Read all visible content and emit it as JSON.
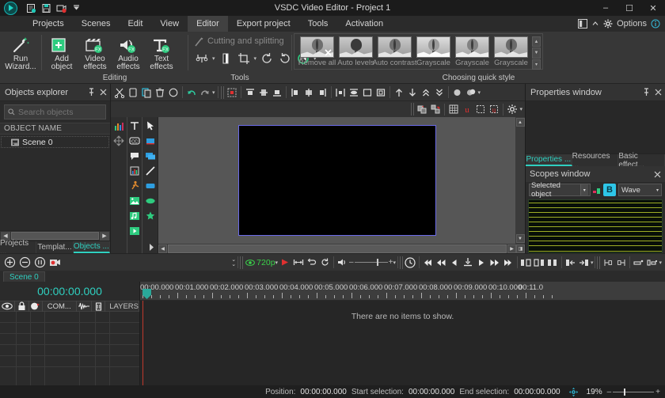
{
  "titlebar": {
    "app_title": "VSDC Video Editor - Project 1",
    "quick_access": [
      {
        "name": "new-project-icon",
        "label": "New project"
      },
      {
        "name": "save-project-icon",
        "label": "Save project"
      },
      {
        "name": "record-icon",
        "label": "Record"
      },
      {
        "name": "customize-qat-icon",
        "label": "Customize"
      }
    ],
    "window_controls": {
      "minimize": "–",
      "maximize": "☐",
      "close": "✕"
    }
  },
  "menu": {
    "items": [
      {
        "label": "Projects",
        "active": false
      },
      {
        "label": "Scenes",
        "active": false
      },
      {
        "label": "Edit",
        "active": false
      },
      {
        "label": "View",
        "active": false
      },
      {
        "label": "Editor",
        "active": true
      },
      {
        "label": "Export project",
        "active": false
      },
      {
        "label": "Tools",
        "active": false
      },
      {
        "label": "Activation",
        "active": false
      }
    ],
    "options_label": "Options"
  },
  "ribbon": {
    "wizard": {
      "label_line1": "Run",
      "label_line2": "Wizard...",
      "icon": "magic-wand-icon"
    },
    "editing": {
      "group_label": "Editing",
      "buttons": [
        {
          "label_line1": "Add",
          "label_line2": "object",
          "icon": "add-object-icon"
        },
        {
          "label_line1": "Video",
          "label_line2": "effects",
          "icon": "video-effects-icon"
        },
        {
          "label_line1": "Audio",
          "label_line2": "effects",
          "icon": "audio-effects-icon"
        },
        {
          "label_line1": "Text",
          "label_line2": "effects",
          "icon": "text-effects-icon"
        }
      ]
    },
    "tools": {
      "group_label": "Tools",
      "cutting_label": "Cutting and splitting",
      "buttons": [
        {
          "name": "split-icon"
        },
        {
          "name": "marker-icon"
        },
        {
          "name": "crop-icon"
        },
        {
          "name": "rotate-cw-icon"
        },
        {
          "name": "rotate-ccw-icon"
        },
        {
          "name": "color-wheel-icon"
        }
      ]
    },
    "quick_style": {
      "group_label": "Choosing quick style",
      "items": [
        {
          "label": "Remove all"
        },
        {
          "label": "Auto levels"
        },
        {
          "label": "Auto contrast"
        },
        {
          "label": "Grayscale"
        },
        {
          "label": "Grayscale"
        },
        {
          "label": "Grayscale"
        }
      ]
    }
  },
  "objects_explorer": {
    "title": "Objects explorer",
    "search_placeholder": "Search objects",
    "search_value": "",
    "column_header": "OBJECT NAME",
    "rows": [
      {
        "label": "Scene 0",
        "icon": "scene-icon"
      }
    ],
    "tabs": [
      {
        "label": "Projects ...",
        "active": false
      },
      {
        "label": "Templat...",
        "active": false
      },
      {
        "label": "Objects ...",
        "active": true
      }
    ]
  },
  "editor_toolbar": {
    "buttons": [
      {
        "name": "cut-icon"
      },
      {
        "name": "copy-icon"
      },
      {
        "name": "paste-icon"
      },
      {
        "name": "delete-icon"
      },
      {
        "name": "select-ellipse-icon"
      },
      {
        "name": "undo-icon"
      },
      {
        "name": "redo-icon"
      },
      {
        "name": "transform-icon"
      },
      {
        "name": "align-top-icon"
      },
      {
        "name": "align-middle-icon"
      },
      {
        "name": "align-bottom-icon"
      },
      {
        "name": "align-left-icon"
      },
      {
        "name": "align-center-icon"
      },
      {
        "name": "align-right-icon"
      },
      {
        "name": "distribute-h-icon"
      },
      {
        "name": "distribute-v-icon"
      },
      {
        "name": "fit-icon"
      },
      {
        "name": "center-icon"
      },
      {
        "name": "move-up-icon"
      },
      {
        "name": "move-down-icon"
      },
      {
        "name": "bring-front-icon"
      },
      {
        "name": "send-back-icon"
      },
      {
        "name": "group-icon"
      },
      {
        "name": "ungroup-icon"
      }
    ],
    "row2": [
      {
        "name": "duplicate-icon"
      },
      {
        "name": "link-icon"
      },
      {
        "name": "grid-icon"
      },
      {
        "name": "units-icon"
      },
      {
        "name": "snap-icon"
      },
      {
        "name": "units2-icon"
      },
      {
        "name": "settings-gear-icon"
      }
    ]
  },
  "vertical_tools": {
    "left": [
      {
        "name": "chart-bars-icon"
      },
      {
        "name": "move-tool-icon"
      }
    ],
    "middle": [
      {
        "name": "text-tool-icon"
      },
      {
        "name": "subtitle-tool-icon"
      },
      {
        "name": "speech-bubble-icon"
      },
      {
        "name": "chart-tool-icon"
      },
      {
        "name": "sprite-tool-icon"
      },
      {
        "name": "image-tool-icon"
      },
      {
        "name": "audio-tool-icon"
      },
      {
        "name": "video-tool-icon"
      }
    ],
    "right": [
      {
        "name": "pointer-tool-icon"
      },
      {
        "name": "rectangle-filled-icon"
      },
      {
        "name": "layers-icon"
      },
      {
        "name": "line-tool-icon"
      },
      {
        "name": "rounded-rect-icon"
      },
      {
        "name": "ellipse-tool-icon"
      },
      {
        "name": "star-tool-icon"
      }
    ],
    "expand": "expand-arrow-icon"
  },
  "playback": {
    "left_buttons": [
      {
        "name": "zoom-in-icon"
      },
      {
        "name": "zoom-out-icon"
      },
      {
        "name": "zoom-fit-icon"
      },
      {
        "name": "snapshot-icon"
      }
    ],
    "resolution": "720p",
    "preview_buttons": [
      {
        "name": "play-preview-icon"
      },
      {
        "name": "region-preview-icon"
      },
      {
        "name": "loop-back-icon"
      },
      {
        "name": "loop-icon"
      }
    ],
    "volume_icon": "volume-icon",
    "volume_minus": "–",
    "volume_plus": "+",
    "transport": [
      {
        "name": "clock-icon"
      },
      {
        "name": "skip-start-icon"
      },
      {
        "name": "rewind-icon"
      },
      {
        "name": "prev-frame-icon"
      },
      {
        "name": "marker-drop-icon"
      },
      {
        "name": "play-icon"
      },
      {
        "name": "fast-forward-icon"
      },
      {
        "name": "skip-end-icon"
      },
      {
        "name": "split-left-icon"
      },
      {
        "name": "split-right-icon"
      },
      {
        "name": "split-both-icon"
      },
      {
        "name": "trim-in-icon"
      },
      {
        "name": "trim-out-icon"
      },
      {
        "name": "cut-region-icon"
      },
      {
        "name": "delete-region-icon"
      },
      {
        "name": "prop-a-icon"
      },
      {
        "name": "prop-b-icon"
      }
    ]
  },
  "timeline": {
    "scene_tab": "Scene 0",
    "timecode": "00:00:00.000",
    "track_header": {
      "eye_icon": "visibility-icon",
      "lock_icon": "lock-icon",
      "mask_icon": "mask-icon",
      "compose_label": "COM...",
      "wave_icon": "waveform-icon",
      "trash_icon": "trash-icon",
      "layers_label": "LAYERS"
    },
    "empty_message": "There are no items to show.",
    "ruler_labels": [
      "00:00.000",
      "00:01.000",
      "00:02.000",
      "00:03.000",
      "00:04.000",
      "00:05.000",
      "00:06.000",
      "00:07.000",
      "00:08.000",
      "00:09.000",
      "00:10.000",
      "00:11.0"
    ]
  },
  "properties_window": {
    "title": "Properties window",
    "pin_icon": "pin-icon",
    "close_icon": "close-icon",
    "tabs": [
      {
        "label": "Properties ...",
        "active": true
      },
      {
        "label": "Resources ...",
        "active": false
      },
      {
        "label": "Basic effect...",
        "active": false
      }
    ]
  },
  "scopes_window": {
    "title": "Scopes window",
    "close_icon": "close-icon",
    "source_value": "Selected object",
    "channel_button": "B",
    "mode_value": "Wave"
  },
  "status_bar": {
    "position_label": "Position:",
    "position_value": "00:00:00.000",
    "start_label": "Start selection:",
    "start_value": "00:00:00.000",
    "end_label": "End selection:",
    "end_value": "00:00:00.000",
    "fit_icon": "fit-screen-icon",
    "zoom_value": "19%",
    "zoom_minus": "–",
    "zoom_plus": "+"
  }
}
